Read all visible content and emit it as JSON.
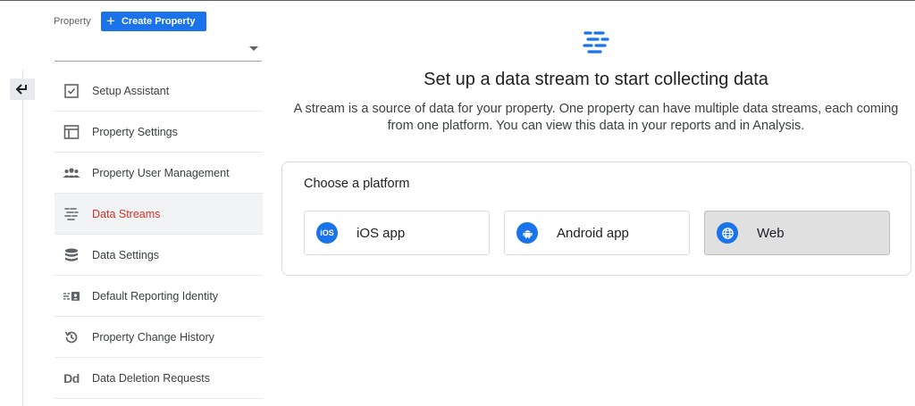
{
  "property": {
    "label": "Property",
    "create_button_icon": "+",
    "create_button_label": "Create Property",
    "selected_value": ""
  },
  "nav": {
    "items": [
      {
        "label": "Setup Assistant",
        "icon": "checkbox-icon"
      },
      {
        "label": "Property Settings",
        "icon": "layout-icon"
      },
      {
        "label": "Property User Management",
        "icon": "people-icon"
      },
      {
        "label": "Data Streams",
        "icon": "streams-icon",
        "active": true
      },
      {
        "label": "Data Settings",
        "icon": "database-icon"
      },
      {
        "label": "Default Reporting Identity",
        "icon": "identity-icon"
      },
      {
        "label": "Property Change History",
        "icon": "history-icon"
      },
      {
        "label": "Data Deletion Requests",
        "icon": "dd-icon",
        "icon_text": "Dd"
      }
    ]
  },
  "main": {
    "title": "Set up a data stream to start collecting data",
    "description": "A stream is a source of data for your property. One property can have multiple data streams, each coming from one platform. You can view this data in your reports and in Analysis.",
    "choose_label": "Choose a platform",
    "platforms": [
      {
        "label": "iOS app",
        "icon": "ios-icon",
        "icon_text": "iOS"
      },
      {
        "label": "Android app",
        "icon": "android-icon"
      },
      {
        "label": "Web",
        "icon": "globe-icon",
        "selected": true
      }
    ]
  },
  "colors": {
    "accent": "#1a73e8",
    "active_nav": "#d93025",
    "selected_platform_bg": "#e0e0e0"
  }
}
